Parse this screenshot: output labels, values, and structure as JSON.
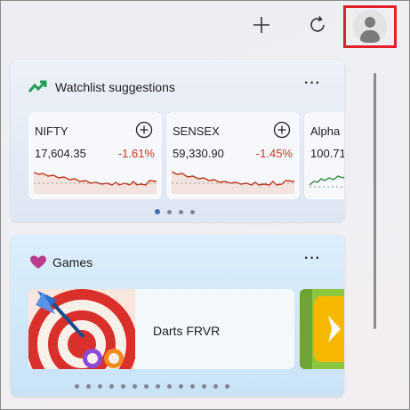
{
  "toolbar": {
    "add_icon": "plus-icon",
    "refresh_icon": "refresh-icon",
    "profile_icon": "avatar-icon",
    "highlight_color": "#e0202a"
  },
  "watchlist": {
    "title": "Watchlist suggestions",
    "more_label": "···",
    "stocks": [
      {
        "symbol": "NIFTY",
        "price": "17,604.35",
        "change": "-1.61%",
        "change_color": "#c8361f"
      },
      {
        "symbol": "SENSEX",
        "price": "59,330.90",
        "change": "-1.45%",
        "change_color": "#c8361f"
      },
      {
        "symbol": "Alpha",
        "price": "100.71",
        "change": "",
        "change_color": "#2c8a3a"
      }
    ],
    "pages": 4,
    "active_page": 0
  },
  "games": {
    "title": "Games",
    "more_label": "···",
    "items": [
      {
        "name": "Darts FRVR"
      }
    ],
    "pages": 14,
    "active_page": 0
  }
}
